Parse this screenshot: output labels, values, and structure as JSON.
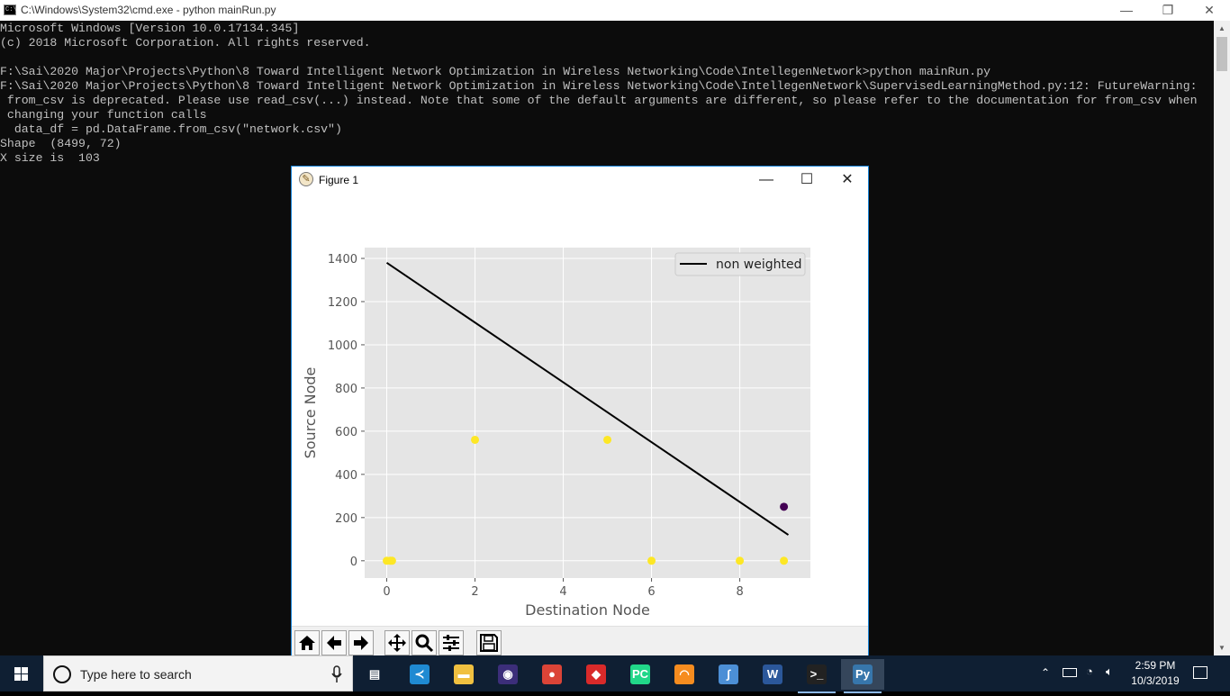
{
  "cmd": {
    "title": "C:\\Windows\\System32\\cmd.exe - python  mainRun.py",
    "lines": [
      "Microsoft Windows [Version 10.0.17134.345]",
      "(c) 2018 Microsoft Corporation. All rights reserved.",
      "",
      "F:\\Sai\\2020 Major\\Projects\\Python\\8 Toward Intelligent Network Optimization in Wireless Networking\\Code\\IntellegenNetwork>python mainRun.py",
      "F:\\Sai\\2020 Major\\Projects\\Python\\8 Toward Intelligent Network Optimization in Wireless Networking\\Code\\IntellegenNetwork\\SupervisedLearningMethod.py:12: FutureWarning:",
      " from_csv is deprecated. Please use read_csv(...) instead. Note that some of the default arguments are different, so please refer to the documentation for from_csv when",
      " changing your function calls",
      "  data_df = pd.DataFrame.from_csv(\"network.csv\")",
      "Shape  (8499, 72)",
      "X size is  103"
    ],
    "colors": {
      "background": "#0c0c0c",
      "text": "#c0c0c0"
    }
  },
  "figure": {
    "title": "Figure 1",
    "toolbar_icons": [
      "home-icon",
      "back-arrow-icon",
      "forward-arrow-icon",
      "pan-icon",
      "zoom-icon",
      "subplots-icon",
      "save-icon"
    ]
  },
  "chart_data": {
    "type": "scatter",
    "title": "",
    "xlabel": "Destination Node",
    "ylabel": "Source Node",
    "xlim": [
      -0.5,
      9.6
    ],
    "ylim": [
      -80,
      1450
    ],
    "xticks": [
      0,
      2,
      4,
      6,
      8
    ],
    "yticks": [
      0,
      200,
      400,
      600,
      800,
      1000,
      1200,
      1400
    ],
    "grid": true,
    "style": "ggplot",
    "legend": {
      "position": "top-right",
      "entries": [
        "non weighted"
      ]
    },
    "series": [
      {
        "name": "non weighted",
        "kind": "line",
        "color": "#000000",
        "x": [
          0,
          9.1
        ],
        "y": [
          1380,
          120
        ]
      },
      {
        "kind": "scatter",
        "points": [
          {
            "x": 0.0,
            "y": 0,
            "color": "#fde725"
          },
          {
            "x": 0.08,
            "y": 0,
            "color": "#fde725"
          },
          {
            "x": 0.12,
            "y": 0,
            "color": "#fde725"
          },
          {
            "x": 2.0,
            "y": 560,
            "color": "#fde725"
          },
          {
            "x": 5.0,
            "y": 560,
            "color": "#fde725"
          },
          {
            "x": 6.0,
            "y": 0,
            "color": "#fde725"
          },
          {
            "x": 8.0,
            "y": 0,
            "color": "#fde725"
          },
          {
            "x": 9.0,
            "y": 250,
            "color": "#440154"
          },
          {
            "x": 9.0,
            "y": 0,
            "color": "#fde725"
          }
        ]
      }
    ],
    "colors": {
      "axes_bg": "#e5e5e5",
      "grid": "#ffffff",
      "tick_text": "#555555",
      "label_text": "#555555"
    }
  },
  "taskbar": {
    "search_placeholder": "Type here to search",
    "apps": [
      {
        "name": "task-view",
        "icon": "task-view-icon"
      },
      {
        "name": "vscode",
        "icon": "vscode-icon",
        "color": "#1f8ad2"
      },
      {
        "name": "file-explorer",
        "icon": "folder-icon",
        "color": "#f0c040"
      },
      {
        "name": "eclipse",
        "icon": "eclipse-icon",
        "color": "#3c2e7a"
      },
      {
        "name": "chrome",
        "icon": "chrome-icon",
        "color": "#db4437"
      },
      {
        "name": "app-red",
        "icon": "red-diamond-icon",
        "color": "#d92a2a"
      },
      {
        "name": "pycharm",
        "icon": "pycharm-icon",
        "color": "#21d789"
      },
      {
        "name": "app-orange",
        "icon": "orange-swirl-icon",
        "color": "#f68c1f"
      },
      {
        "name": "app-dolphin",
        "icon": "dolphin-icon",
        "color": "#4c8fd6"
      },
      {
        "name": "word",
        "icon": "word-icon",
        "color": "#2b579a"
      },
      {
        "name": "cmd",
        "icon": "cmd-icon",
        "color": "#222222"
      },
      {
        "name": "python",
        "icon": "python-icon",
        "color": "#3776ab"
      }
    ],
    "clock_time": "2:59 PM",
    "clock_date": "10/3/2019"
  }
}
